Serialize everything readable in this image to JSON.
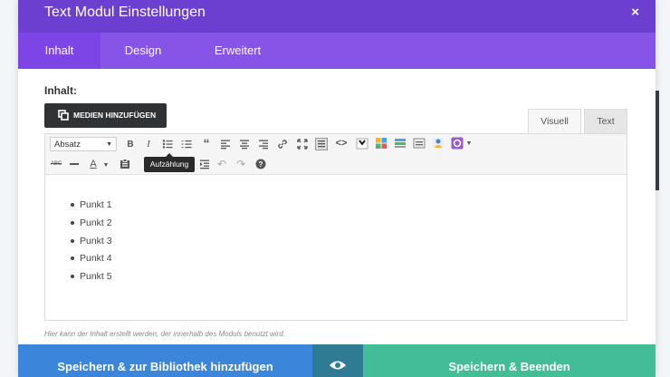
{
  "modal": {
    "title": "Text Modul Einstellungen",
    "close_symbol": "×"
  },
  "tabs": [
    "Inhalt",
    "Design",
    "Erweitert"
  ],
  "content": {
    "section_label": "Inhalt:",
    "media_button_label": "MEDIEN HINZUFÜGEN",
    "editor_tabs": {
      "visual": "Visuell",
      "text": "Text"
    },
    "format_select": "Absatz",
    "tooltip": "Aufzählung",
    "list_items": [
      "Punkt 1",
      "Punkt 2",
      "Punkt 3",
      "Punkt 4",
      "Punkt 5"
    ],
    "hint": "Hier kann der Inhalt erstellt werden, der innerhalb des Moduls benutzt wird."
  },
  "toolbar_icons_row1": [
    "bold-icon",
    "italic-icon",
    "bullet-list-icon",
    "numbered-list-icon",
    "blockquote-icon",
    "align-left-icon",
    "align-center-icon",
    "align-right-icon",
    "link-icon",
    "fullscreen-icon",
    "toolbar-toggle-icon",
    "code-icon",
    "shortcode-icon",
    "layout-icon",
    "tabs-icon",
    "slider-icon",
    "person-icon",
    "settings-icon"
  ],
  "toolbar_icons_row2": [
    "strikethrough-icon",
    "horizontal-line-icon",
    "text-color-icon",
    "paste-as-text-icon",
    "clear-formatting-icon",
    "indent-icon",
    "undo-icon",
    "redo-icon",
    "help-icon"
  ],
  "footer": {
    "save_library_label": "Speichern & zur Bibliothek hinzufügen",
    "save_end_label": "Speichern & Beenden"
  },
  "colors": {
    "header": "#6c3fd1",
    "tabs_bar": "#8654e6",
    "save_library": "#3b86db",
    "preview": "#2f7b94",
    "save_end": "#42bd97"
  }
}
